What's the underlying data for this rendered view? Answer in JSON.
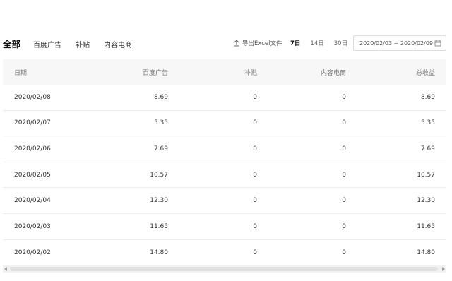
{
  "tabs": {
    "categories": [
      "全部",
      "百度广告",
      "补贴",
      "内容电商"
    ],
    "active_index": 0
  },
  "toolbar": {
    "export_label": "导出Excel文件",
    "day_ranges": [
      "7日",
      "14日",
      "30日"
    ],
    "active_day_index": 0,
    "date_range": "2020/02/03 ~ 2020/02/09"
  },
  "table": {
    "headers": [
      "日期",
      "百度广告",
      "补贴",
      "内容电商",
      "总收益"
    ],
    "rows": [
      [
        "2020/02/08",
        "8.69",
        "0",
        "0",
        "8.69"
      ],
      [
        "2020/02/07",
        "5.35",
        "0",
        "0",
        "5.35"
      ],
      [
        "2020/02/06",
        "7.69",
        "0",
        "0",
        "7.69"
      ],
      [
        "2020/02/05",
        "10.57",
        "0",
        "0",
        "10.57"
      ],
      [
        "2020/02/04",
        "12.30",
        "0",
        "0",
        "12.30"
      ],
      [
        "2020/02/03",
        "11.65",
        "0",
        "0",
        "11.65"
      ],
      [
        "2020/02/02",
        "14.80",
        "0",
        "0",
        "14.80"
      ]
    ]
  },
  "icons": {
    "export": "upload-icon",
    "date": "calendar-icon"
  }
}
